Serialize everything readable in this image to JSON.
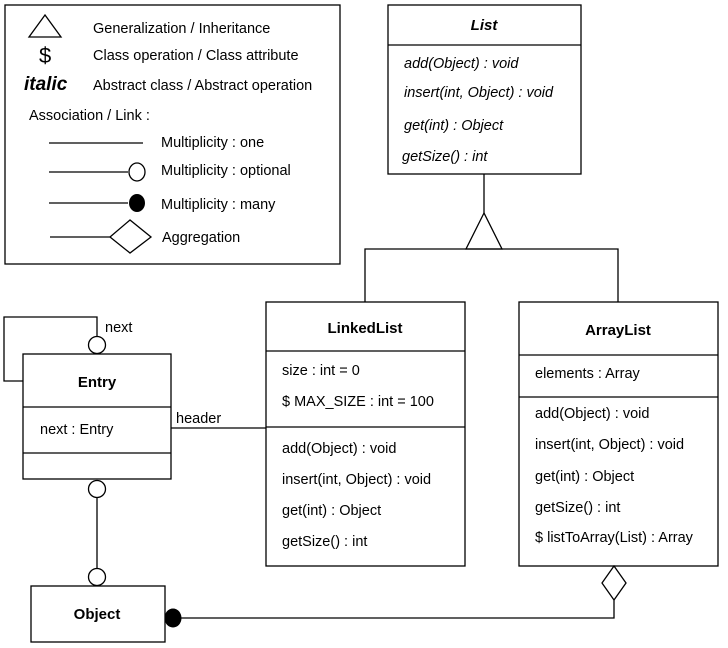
{
  "legend": {
    "items": [
      {
        "symbol": "triangle",
        "label": "Generalization / Inheritance"
      },
      {
        "symbol": "$",
        "label": "Class operation / Class attribute"
      },
      {
        "symbol": "italic",
        "label": "Abstract class / Abstract operation"
      }
    ],
    "association_title": "Association / Link :",
    "links": [
      {
        "end": "none",
        "label": "Multiplicity : one"
      },
      {
        "end": "open-circle",
        "label": "Multiplicity : optional"
      },
      {
        "end": "filled-circle",
        "label": "Multiplicity : many"
      },
      {
        "end": "diamond",
        "label": "Aggregation"
      }
    ]
  },
  "classes": {
    "list": {
      "name": "List",
      "abstract": true,
      "operations": [
        "add(Object) : void",
        "insert(int, Object) : void",
        "get(int) : Object",
        "getSize() : int"
      ]
    },
    "linkedlist": {
      "name": "LinkedList",
      "attributes": [
        "size : int = 0",
        "$ MAX_SIZE : int = 100"
      ],
      "operations": [
        "add(Object) : void",
        "insert(int, Object) : void",
        "get(int) : Object",
        "getSize() : int"
      ]
    },
    "arraylist": {
      "name": "ArrayList",
      "attributes": [
        "elements : Array"
      ],
      "operations": [
        "add(Object) : void",
        "insert(int, Object) : void",
        "get(int) : Object",
        "getSize() : int",
        "$ listToArray(List) : Array"
      ]
    },
    "entry": {
      "name": "Entry",
      "attributes": [
        "next : Entry"
      ],
      "operations": []
    },
    "object": {
      "name": "Object"
    }
  },
  "relations": {
    "self_link_label": "next",
    "header_label": "header"
  }
}
